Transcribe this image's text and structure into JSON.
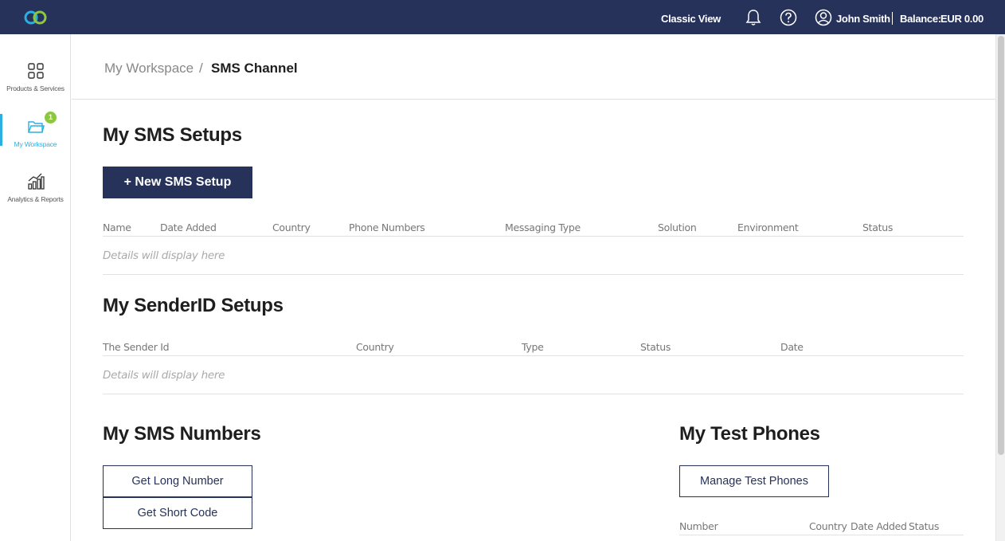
{
  "header": {
    "classic_view": "Classic View",
    "user_name": "John Smith",
    "balance_label": "Balance:",
    "balance_value": "EUR 0.00",
    "icons": [
      "bell-icon",
      "help-icon",
      "user-icon"
    ]
  },
  "sidebar": {
    "items": [
      {
        "label": "Products & Services",
        "icon": "grid-icon"
      },
      {
        "label": "My Workspace",
        "icon": "folder-icon",
        "badge": "1"
      },
      {
        "label": "Analytics & Reports",
        "icon": "chart-icon"
      }
    ],
    "accent": "#2ab0e0",
    "badge_color": "#8dc63f"
  },
  "breadcrumb": {
    "home": "My Workspace",
    "separator": "/",
    "current": "SMS Channel"
  },
  "sms_setups": {
    "title": "My SMS Setups",
    "new_button": "+ New SMS Setup",
    "columns": [
      "Name",
      "Date Added",
      "Country",
      "Phone Numbers",
      "Messaging Type",
      "Solution",
      "Environment",
      "Status"
    ],
    "empty": "Details will display here"
  },
  "senderid_setups": {
    "title": "My SenderID Setups",
    "columns": [
      "The Sender Id",
      "Country",
      "Type",
      "Status",
      "Date"
    ],
    "empty": "Details will display here"
  },
  "sms_numbers": {
    "title": "My SMS Numbers",
    "long_button": "Get Long Number",
    "short_button": "Get Short Code"
  },
  "test_phones": {
    "title": "My Test Phones",
    "manage_button": "Manage Test Phones",
    "columns": [
      "Number",
      "Country",
      "Date Added",
      "Status"
    ]
  },
  "colors": {
    "navy": "#26325a"
  }
}
